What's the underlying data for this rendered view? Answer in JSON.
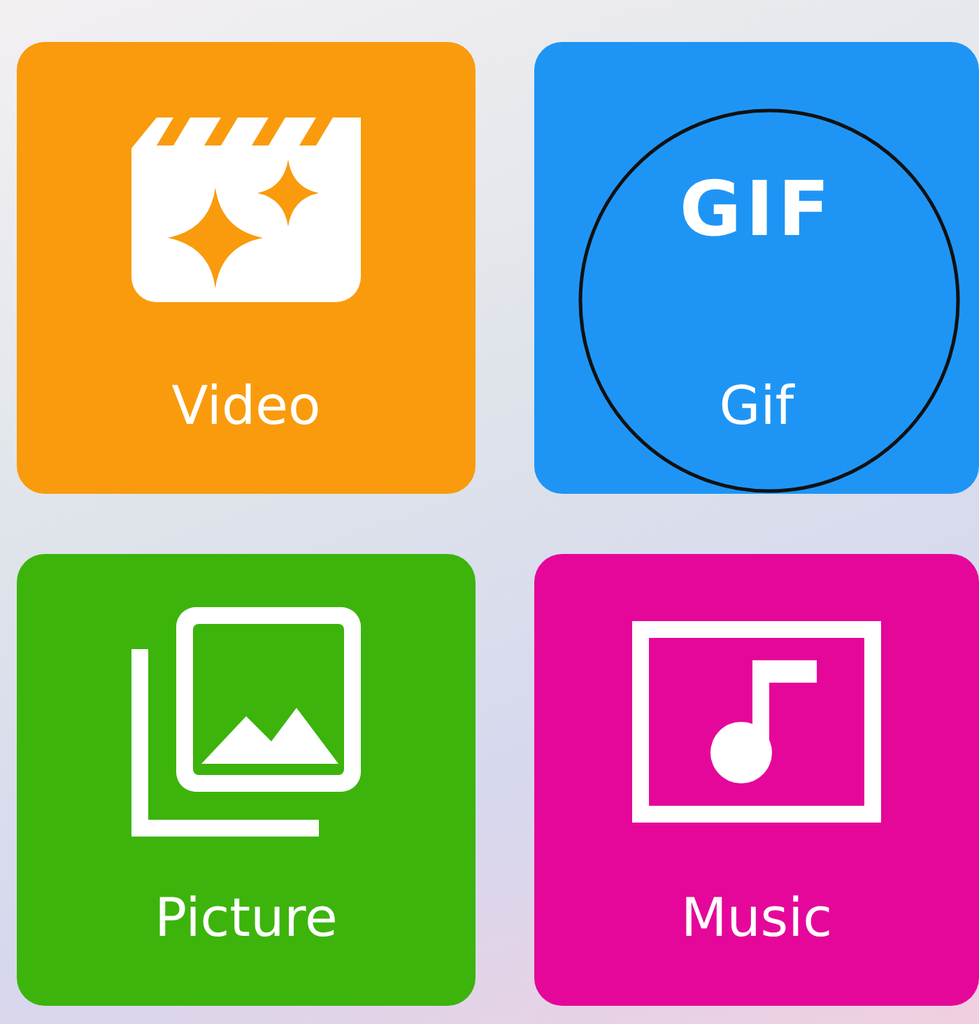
{
  "gif_icon_text": "GIF",
  "tiles": [
    {
      "kind": "video",
      "label": "Video",
      "color": "#f99b0c",
      "circled": false
    },
    {
      "kind": "gif",
      "label": "Gif",
      "color": "#1e95f5",
      "circled": true
    },
    {
      "kind": "picture",
      "label": "Picture",
      "color": "#3cb40c",
      "circled": false
    },
    {
      "kind": "music",
      "label": "Music",
      "color": "#e5079a",
      "circled": false
    }
  ]
}
